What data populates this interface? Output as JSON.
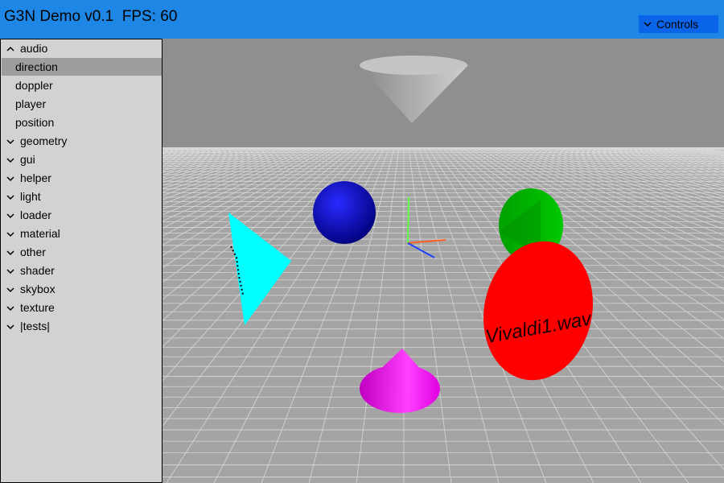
{
  "header": {
    "title": "G3N Demo v0.1  FPS: 60",
    "controls_label": "Controls"
  },
  "sidebar": {
    "items": [
      {
        "label": "audio",
        "kind": "category",
        "expanded": true
      },
      {
        "label": "direction",
        "kind": "child",
        "selected": true
      },
      {
        "label": "doppler",
        "kind": "child"
      },
      {
        "label": "player",
        "kind": "child"
      },
      {
        "label": "position",
        "kind": "child"
      },
      {
        "label": "geometry",
        "kind": "category"
      },
      {
        "label": "gui",
        "kind": "category"
      },
      {
        "label": "helper",
        "kind": "category"
      },
      {
        "label": "light",
        "kind": "category"
      },
      {
        "label": "loader",
        "kind": "category"
      },
      {
        "label": "material",
        "kind": "category"
      },
      {
        "label": "other",
        "kind": "category"
      },
      {
        "label": "shader",
        "kind": "category"
      },
      {
        "label": "skybox",
        "kind": "category"
      },
      {
        "label": "texture",
        "kind": "category"
      },
      {
        "label": "|tests|",
        "kind": "category"
      }
    ]
  },
  "scene": {
    "disk_text": "Vivaldi1.wav",
    "colors": {
      "header": "#1e87e5",
      "sidebar": "#d2d3d0",
      "wall": "#8f8f8f",
      "floor": "#a4a4a4",
      "grid": "#d8d8d8",
      "sphere": "#0a0af0",
      "cone_green": "#00b400",
      "disk_red": "#ff0000",
      "cone_magenta": "#f010f0",
      "cone_cyan": "#00ffff"
    }
  }
}
